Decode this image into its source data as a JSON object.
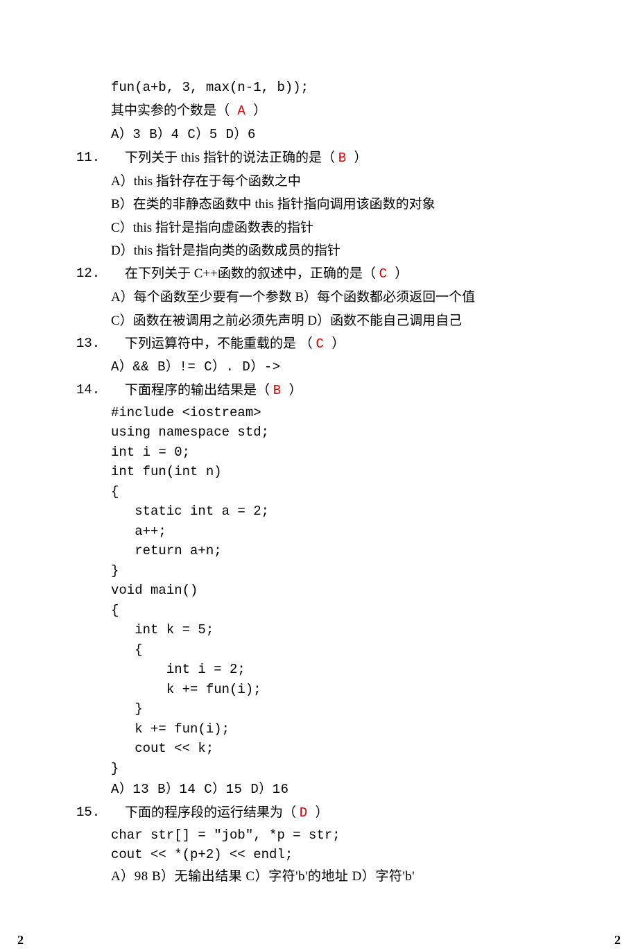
{
  "q10_cont": {
    "code_line": "fun(a+b, 3, max(n-1, b));",
    "stem": "其中实参的个数是（",
    "answer": "  A  ",
    "stem_close": "  ）",
    "opts": "A）3       B）4         C）5         D）6"
  },
  "q11": {
    "num": "11.",
    "stem": "下列关于 this 指针的说法正确的是（  ",
    "answer": " B  ",
    "stem_close": " ）",
    "optA": "A）this 指针存在于每个函数之中",
    "optB": "B）在类的非静态函数中 this 指针指向调用该函数的对象",
    "optC": "C）this 指针是指向虚函数表的指针",
    "optD": "D）this 指针是指向类的函数成员的指针"
  },
  "q12": {
    "num": "12.",
    "stem": "在下列关于 C++函数的叙述中，正确的是（  ",
    "answer": "C  ",
    "stem_close": " ）",
    "optsAB": "A）每个函数至少要有一个参数    B）每个函数都必须返回一个值",
    "optsCD": "C）函数在被调用之前必须先声明  D）函数不能自己调用自己"
  },
  "q13": {
    "num": "13.",
    "stem": "下列运算符中，不能重载的是  （  ",
    "answer": "C  ",
    "stem_close": " ）",
    "opts": "A）&&       B）!=        C）.          D）->"
  },
  "q14": {
    "num": "14.",
    "stem": "下面程序的输出结果是（   ",
    "answer": "B ",
    "stem_close": " ）",
    "code": "#include <iostream>\nusing namespace std;\nint i = 0;\nint fun(int n)\n{\n   static int a = 2;\n   a++;\n   return a+n;\n}\nvoid main()\n{\n   int k = 5;\n   {\n       int i = 2;\n       k += fun(i);\n   }\n   k += fun(i);\n   cout << k;\n}",
    "opts": "A）13       B）14         C）15         D）16"
  },
  "q15": {
    "num": "15.",
    "stem": "下面的程序段的运行结果为（   ",
    "answer": " D  ",
    "stem_close": " ）",
    "code": "char str[] = \"job\", *p = str;\ncout << *(p+2) << endl;",
    "opts": "A）98      B）无输出结果      C）字符'b'的地址      D）字符'b'"
  },
  "footer": {
    "left": "2",
    "right": "2"
  }
}
